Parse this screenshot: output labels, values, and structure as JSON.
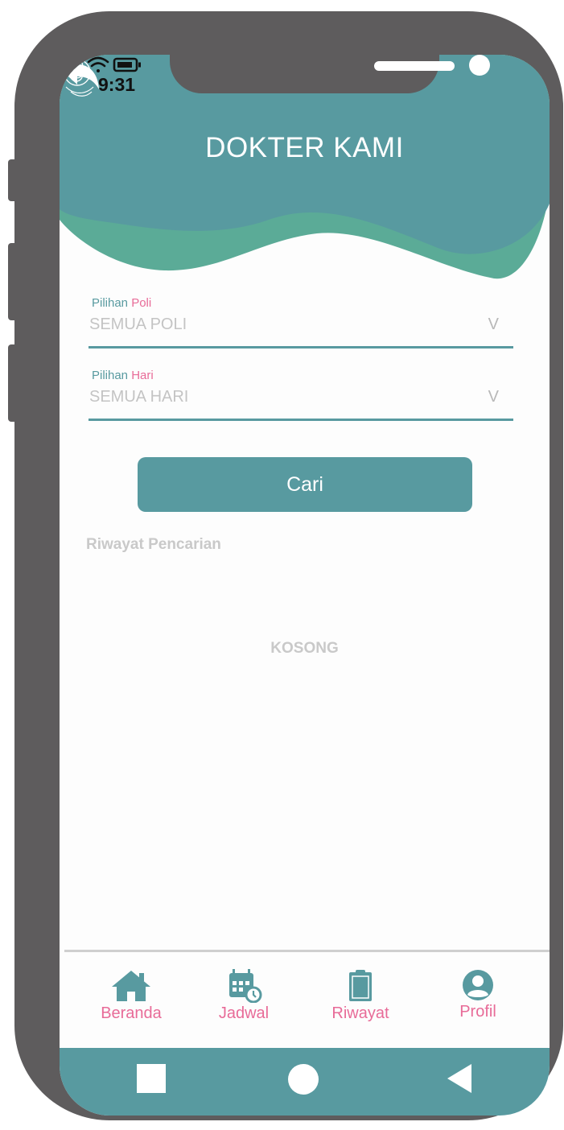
{
  "status_bar": {
    "time": "9:31"
  },
  "header": {
    "title": "DOKTER KAMI"
  },
  "form": {
    "poli": {
      "label_prefix": "Pilihan",
      "label_accent": "Poli",
      "value": "SEMUA POLI",
      "chevron": "V"
    },
    "hari": {
      "label_prefix": "Pilihan",
      "label_accent": "Hari",
      "value": "SEMUA HARI",
      "chevron": "V"
    }
  },
  "search_button": {
    "label": "Cari"
  },
  "history": {
    "title": "Riwayat Pencarian",
    "empty_text": "KOSONG"
  },
  "bottom_nav": {
    "items": [
      {
        "label": "Beranda",
        "icon": "home-icon"
      },
      {
        "label": "Jadwal",
        "icon": "calendar-clock-icon"
      },
      {
        "label": "Riwayat",
        "icon": "clipboard-icon"
      },
      {
        "label": "Profil",
        "icon": "user-icon"
      }
    ]
  },
  "colors": {
    "primary": "#589aa0",
    "secondary_wave": "#5bab97",
    "accent_pink": "#e86b98",
    "muted_text": "#c4c4c4",
    "phone_frame": "#5e5c5d"
  }
}
